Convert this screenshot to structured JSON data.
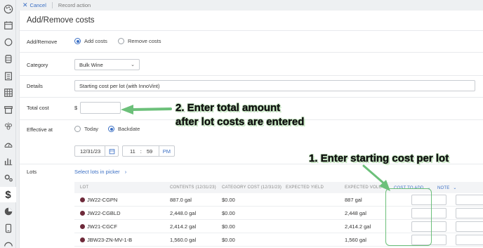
{
  "topbar": {
    "cancel_label": "Cancel",
    "record_action_label": "Record action"
  },
  "page": {
    "title": "Add/Remove costs"
  },
  "form": {
    "add_remove": {
      "label": "Add/Remove",
      "options": [
        "Add costs",
        "Remove costs"
      ],
      "selected": "Add costs"
    },
    "category": {
      "label": "Category",
      "value": "Bulk Wine"
    },
    "details": {
      "label": "Details",
      "value": "Starting cost per lot (with InnoVint)"
    },
    "total_cost": {
      "label": "Total cost",
      "currency": "$",
      "value": ""
    },
    "effective_at": {
      "label": "Effective at",
      "options": [
        "Today",
        "Backdate"
      ],
      "selected": "Backdate",
      "date": "12/31/23",
      "hour": "11",
      "colon": ":",
      "minute": "59",
      "ampm": "PM"
    },
    "lots": {
      "label": "Lots",
      "picker_link": "Select lots in picker"
    }
  },
  "table": {
    "headers": {
      "lot": "LOT",
      "contents": "CONTENTS (12/31/23)",
      "category_cost": "CATEGORY COST (12/31/23)",
      "expected_yield": "EXPECTED YIELD",
      "expected_volume": "EXPECTED VOLU",
      "cost_to_add": "COST TO ADD",
      "note": "NOTE"
    },
    "rows": [
      {
        "lot": "JW22-CGPN",
        "contents": "887.0 gal",
        "category_cost": "$0.00",
        "expected_volume": "887 gal"
      },
      {
        "lot": "JW22-CGBLD",
        "contents": "2,448.0 gal",
        "category_cost": "$0.00",
        "expected_volume": "2,448 gal"
      },
      {
        "lot": "JW21-CGCF",
        "contents": "2,414.2 gal",
        "category_cost": "$0.00",
        "expected_volume": "2,414.2 gal"
      },
      {
        "lot": "JBW23-ZN-MV-1-B",
        "contents": "1,560.0 gal",
        "category_cost": "$0.00",
        "expected_volume": "1,560 gal"
      }
    ]
  },
  "annotations": {
    "step2_line1": "2. Enter total amount",
    "step2_line2": "after lot costs are entered",
    "step1": "1. Enter starting cost per lot"
  },
  "colors": {
    "accent": "#3b6fc4",
    "annotation_green": "#6cc07a",
    "lot_dot": "#6e2a3a"
  },
  "sidebar": {
    "icons": [
      "palette-icon",
      "calendar-icon",
      "circle-icon",
      "barrel-icon",
      "clipboard-icon",
      "grid-icon",
      "archive-icon",
      "vineyard-icon",
      "scale-icon",
      "bar-chart-icon",
      "settings-icon",
      "dollar-icon",
      "pie-chart-icon",
      "phone-icon",
      "gauge-icon"
    ],
    "active_glyph": "$"
  }
}
